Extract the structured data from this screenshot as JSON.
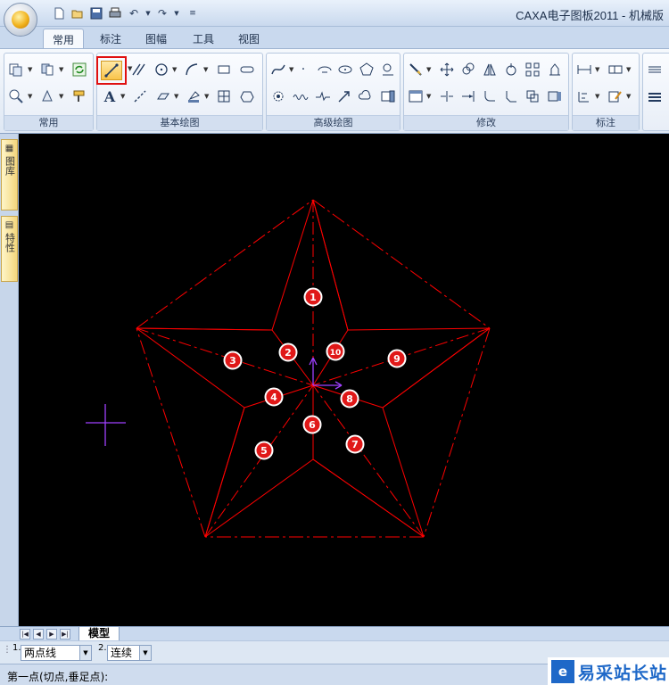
{
  "window": {
    "title": "CAXA电子图板2011 - 机械版"
  },
  "quick_access": [
    "new-icon",
    "open-icon",
    "save-icon",
    "print-icon",
    "undo-icon",
    "redo-icon"
  ],
  "ribbon_tabs": [
    {
      "label": "常用",
      "active": true
    },
    {
      "label": "标注",
      "active": false
    },
    {
      "label": "图幅",
      "active": false
    },
    {
      "label": "工具",
      "active": false
    },
    {
      "label": "视图",
      "active": false
    }
  ],
  "ribbon_groups": {
    "common": "常用",
    "basic_draw": "基本绘图",
    "advanced_draw": "高级绘图",
    "modify": "修改",
    "annotate": "标注"
  },
  "side_panels": [
    {
      "label": "图库",
      "icon": "library-icon"
    },
    {
      "label": "特性",
      "icon": "properties-icon"
    }
  ],
  "drawing": {
    "line_color": "#ff0000",
    "ucs_color": "#a040ff",
    "markers": [
      "1",
      "2",
      "3",
      "4",
      "5",
      "6",
      "7",
      "8",
      "9",
      "10"
    ]
  },
  "sheet": {
    "model_tab": "模型"
  },
  "command_bar": {
    "option1_num": "1.",
    "option1_value": "两点线",
    "option2_num": "2.",
    "option2_value": "连续"
  },
  "status": {
    "prompt": "第一点(切点,垂足点):"
  },
  "watermark": {
    "logo": "e",
    "text": "易采站长站"
  }
}
